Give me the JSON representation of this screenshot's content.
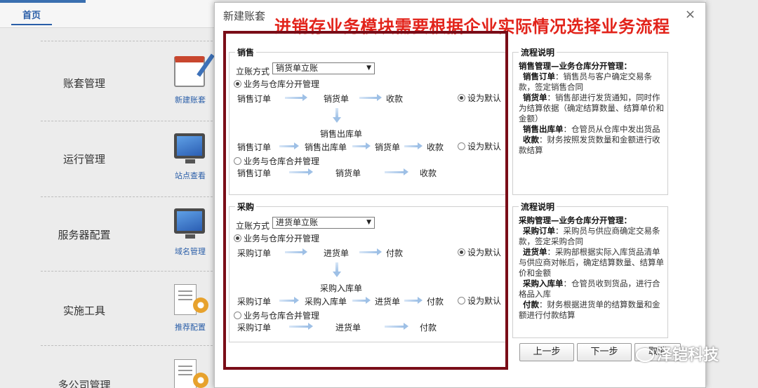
{
  "topbar": {
    "home_tab": "首页"
  },
  "modules": [
    {
      "label": "账套管理",
      "sub": "新建账套",
      "icon": "calendar-pencil-icon"
    },
    {
      "label": "运行管理",
      "sub": "站点查看",
      "icon": "monitor-icon"
    },
    {
      "label": "服务器配置",
      "sub": "域名管理",
      "icon": "monitor-icon"
    },
    {
      "label": "实施工具",
      "sub": "推荐配置",
      "icon": "document-gear-icon"
    },
    {
      "label": "多公司管理",
      "sub": "",
      "icon": "document-icon"
    }
  ],
  "dialog": {
    "title": "新建账套",
    "close": "×",
    "annotation": "进销存业务模块需要根据企业实际情况选择业务流程",
    "sales": {
      "legend": "销售",
      "mode_label": "立账方式",
      "mode_value": "销货单立账",
      "opt_separate": "业务与仓库分开管理",
      "opt_merge": "业务与仓库合并管理",
      "flow1": [
        "销售订单",
        "销货单",
        "收款"
      ],
      "mid_label": "销售出库单",
      "flow2": [
        "销售订单",
        "销售出库单",
        "销货单",
        "收款"
      ],
      "flow3": [
        "销售订单",
        "销货单",
        "收款"
      ],
      "default1": "设为默认",
      "default2": "设为默认"
    },
    "purchase": {
      "legend": "采购",
      "mode_label": "立账方式",
      "mode_value": "进货单立账",
      "opt_separate": "业务与仓库分开管理",
      "opt_merge": "业务与仓库合并管理",
      "flow1": [
        "采购订单",
        "进货单",
        "付款"
      ],
      "mid_label": "采购入库单",
      "flow2": [
        "采购订单",
        "采购入库单",
        "进货单",
        "付款"
      ],
      "flow3": [
        "采购订单",
        "进货单",
        "付款"
      ],
      "default1": "设为默认",
      "default2": "设为默认"
    },
    "sales_desc": {
      "legend": "流程说明",
      "heading": "销售管理—业务仓库分开管理：",
      "items": [
        {
          "term": "销售订单",
          "text": "：销售员与客户确定交易条款，签定销售合同"
        },
        {
          "term": "销货单",
          "text": "：销售部进行发货通知，同时作为结算依据（确定结算数量、结算单价和金额）"
        },
        {
          "term": "销售出库单",
          "text": "：仓管员从仓库中发出货品"
        },
        {
          "term": "收款",
          "text": "：财务按照发货数量和金额进行收款结算"
        }
      ]
    },
    "purchase_desc": {
      "legend": "流程说明",
      "heading": "采购管理—业务仓库分开管理：",
      "items": [
        {
          "term": "采购订单",
          "text": "：采购员与供应商确定交易条款，签定采购合同"
        },
        {
          "term": "进货单",
          "text": "：采购部根据实际入库货品清单与供应商对帐后，确定结算数量、结算单价和金额"
        },
        {
          "term": "采购入库单",
          "text": "：仓管员收到货品，进行合格品入库"
        },
        {
          "term": "付款",
          "text": "：财务根据进货单的结算数量和金额进行付款结算"
        }
      ]
    },
    "buttons": {
      "prev": "上一步",
      "next": "下一步",
      "cancel": "取消"
    }
  },
  "watermark": "泽铠科技"
}
